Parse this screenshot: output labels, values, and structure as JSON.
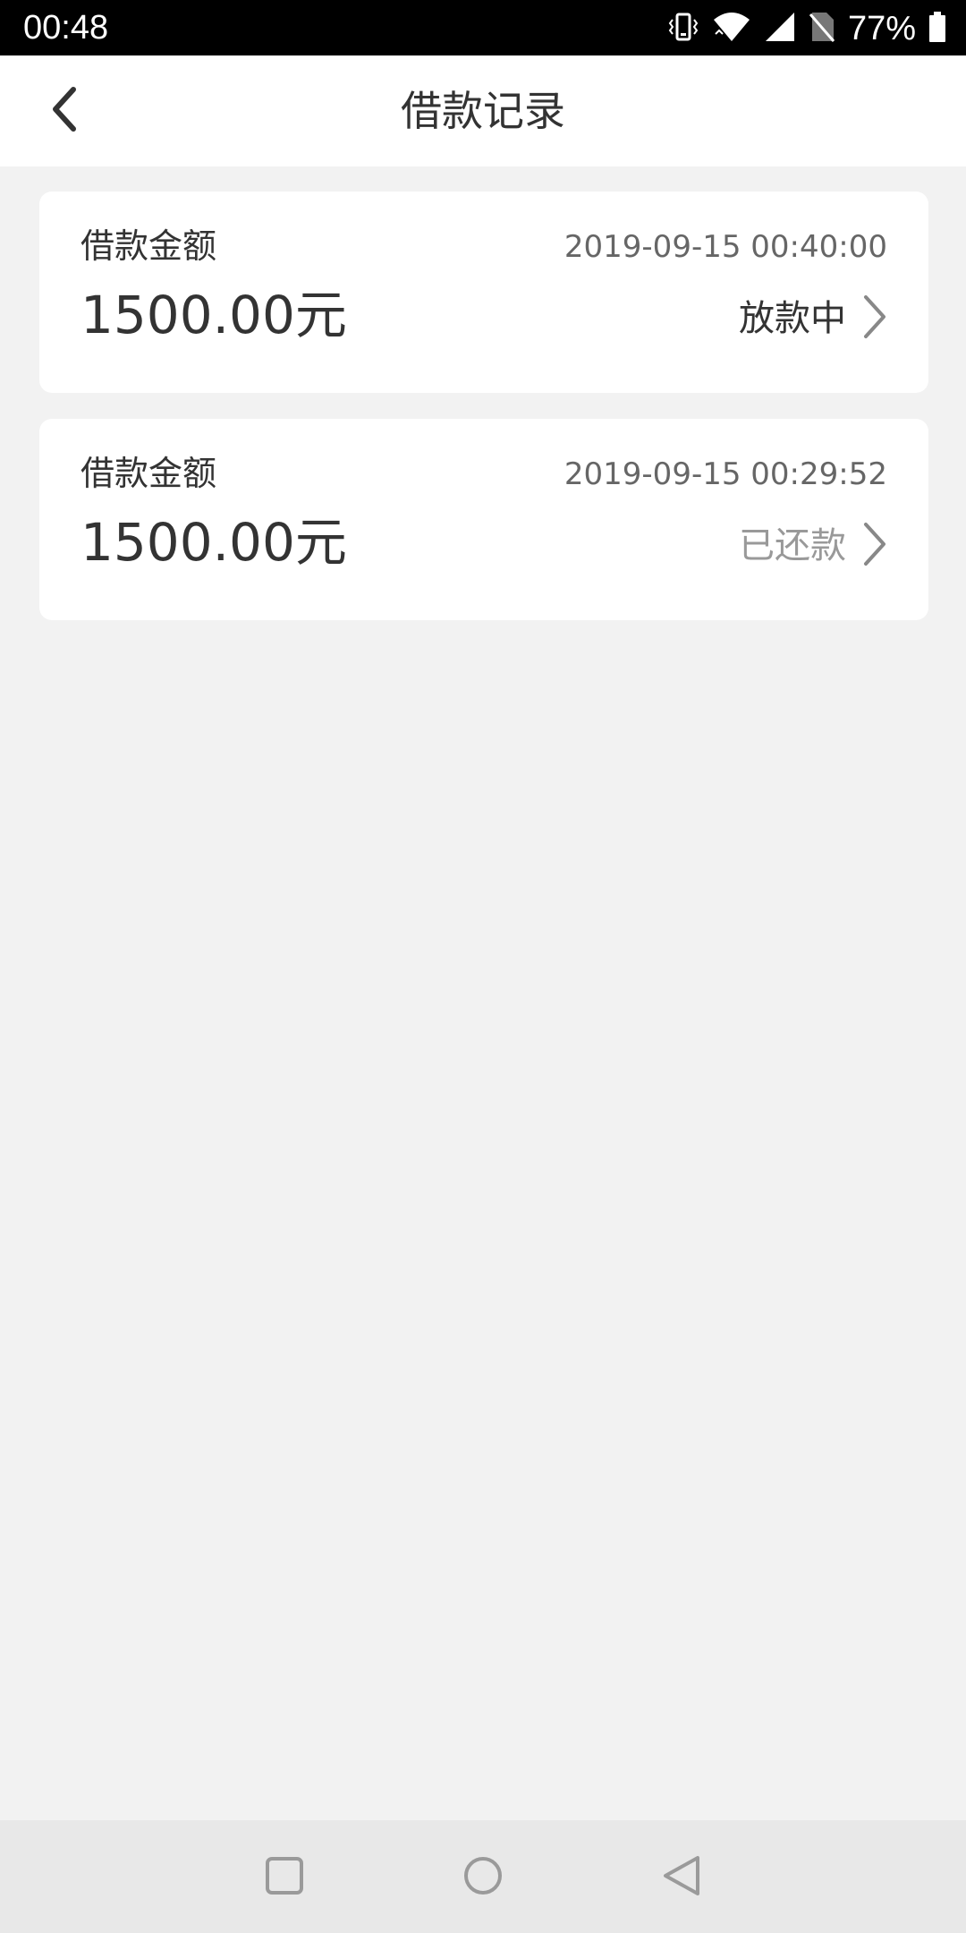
{
  "status_bar": {
    "time": "00:48",
    "battery": "77%",
    "icons": [
      "vibrate-icon",
      "wifi-icon",
      "signal-icon",
      "no-sim-icon",
      "battery-icon"
    ]
  },
  "header": {
    "title": "借款记录",
    "back_icon": "chevron-left-icon"
  },
  "records": [
    {
      "label": "借款金额",
      "time": "2019-09-15 00:40:00",
      "amount": "1500.00元",
      "status": "放款中",
      "status_color": "#333333"
    },
    {
      "label": "借款金额",
      "time": "2019-09-15 00:29:52",
      "amount": "1500.00元",
      "status": "已还款",
      "status_color": "#999999"
    }
  ],
  "system_nav": {
    "buttons": [
      "recents-icon",
      "home-icon",
      "back-triangle-icon"
    ]
  },
  "colors": {
    "background": "#f2f2f2",
    "card": "#ffffff",
    "text_primary": "#333333",
    "text_secondary": "#666666",
    "chevron": "#888888"
  }
}
